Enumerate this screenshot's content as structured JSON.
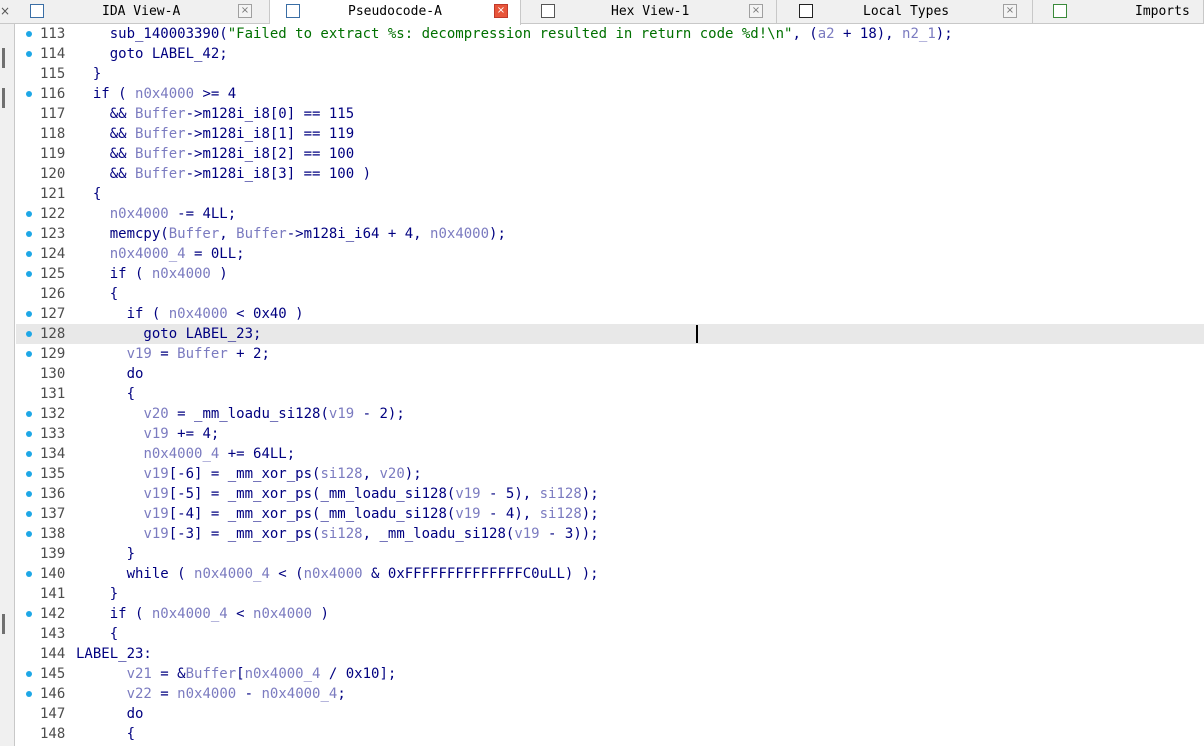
{
  "tabs": [
    {
      "label": "IDA View-A",
      "icon": "ida-view-icon",
      "active": false
    },
    {
      "label": "Pseudocode-A",
      "icon": "pseudocode-icon",
      "active": true
    },
    {
      "label": "Hex View-1",
      "icon": "hex-view-icon",
      "active": false
    },
    {
      "label": "Local Types",
      "icon": "local-types-icon",
      "active": false
    },
    {
      "label": "Imports",
      "icon": "imports-icon",
      "active": false
    }
  ],
  "close_glyph": "×",
  "code": {
    "lines": [
      {
        "n": "113",
        "dot": true,
        "t": [
          [
            "    sub_140003390(",
            ""
          ],
          [
            "\"Failed to extract %s: decompression resulted in return code %d!\\n\"",
            "str"
          ],
          [
            ", (",
            ""
          ],
          [
            "a2",
            "var"
          ],
          [
            " + 18), ",
            ""
          ],
          [
            "n2_1",
            "var"
          ],
          [
            ");",
            ""
          ]
        ]
      },
      {
        "n": "114",
        "dot": true,
        "t": [
          [
            "    goto LABEL_42;",
            ""
          ]
        ]
      },
      {
        "n": "115",
        "dot": false,
        "t": [
          [
            "  }",
            ""
          ]
        ]
      },
      {
        "n": "116",
        "dot": true,
        "t": [
          [
            "  if ( ",
            ""
          ],
          [
            "n0x4000",
            "var"
          ],
          [
            " >= 4",
            ""
          ]
        ]
      },
      {
        "n": "117",
        "dot": false,
        "t": [
          [
            "    && ",
            ""
          ],
          [
            "Buffer",
            "var"
          ],
          [
            "->m128i_i8[0] == 115",
            ""
          ]
        ]
      },
      {
        "n": "118",
        "dot": false,
        "t": [
          [
            "    && ",
            ""
          ],
          [
            "Buffer",
            "var"
          ],
          [
            "->m128i_i8[1] == 119",
            ""
          ]
        ]
      },
      {
        "n": "119",
        "dot": false,
        "t": [
          [
            "    && ",
            ""
          ],
          [
            "Buffer",
            "var"
          ],
          [
            "->m128i_i8[2] == 100",
            ""
          ]
        ]
      },
      {
        "n": "120",
        "dot": false,
        "t": [
          [
            "    && ",
            ""
          ],
          [
            "Buffer",
            "var"
          ],
          [
            "->m128i_i8[3] == 100 )",
            ""
          ]
        ]
      },
      {
        "n": "121",
        "dot": false,
        "t": [
          [
            "  {",
            ""
          ]
        ]
      },
      {
        "n": "122",
        "dot": true,
        "t": [
          [
            "    ",
            ""
          ],
          [
            "n0x4000",
            "var"
          ],
          [
            " -= 4LL;",
            ""
          ]
        ]
      },
      {
        "n": "123",
        "dot": true,
        "t": [
          [
            "    memcpy(",
            ""
          ],
          [
            "Buffer",
            "var"
          ],
          [
            ", ",
            ""
          ],
          [
            "Buffer",
            "var"
          ],
          [
            "->m128i_i64 + 4, ",
            ""
          ],
          [
            "n0x4000",
            "var"
          ],
          [
            ");",
            ""
          ]
        ]
      },
      {
        "n": "124",
        "dot": true,
        "t": [
          [
            "    ",
            ""
          ],
          [
            "n0x4000_4",
            "var"
          ],
          [
            " = 0LL;",
            ""
          ]
        ]
      },
      {
        "n": "125",
        "dot": true,
        "t": [
          [
            "    if ( ",
            ""
          ],
          [
            "n0x4000",
            "var"
          ],
          [
            " )",
            ""
          ]
        ]
      },
      {
        "n": "126",
        "dot": false,
        "t": [
          [
            "    {",
            ""
          ]
        ]
      },
      {
        "n": "127",
        "dot": true,
        "t": [
          [
            "      if ( ",
            ""
          ],
          [
            "n0x4000",
            "var"
          ],
          [
            " < 0x40 )",
            ""
          ]
        ]
      },
      {
        "n": "128",
        "dot": true,
        "t": [
          [
            "        goto LABEL_23;",
            ""
          ]
        ]
      },
      {
        "n": "129",
        "dot": true,
        "t": [
          [
            "      ",
            ""
          ],
          [
            "v19",
            "var"
          ],
          [
            " = ",
            ""
          ],
          [
            "Buffer",
            "var"
          ],
          [
            " + 2;",
            ""
          ]
        ]
      },
      {
        "n": "130",
        "dot": false,
        "t": [
          [
            "      do",
            ""
          ]
        ]
      },
      {
        "n": "131",
        "dot": false,
        "t": [
          [
            "      {",
            ""
          ]
        ]
      },
      {
        "n": "132",
        "dot": true,
        "t": [
          [
            "        ",
            ""
          ],
          [
            "v20",
            "var"
          ],
          [
            " = _mm_loadu_si128(",
            ""
          ],
          [
            "v19",
            "var"
          ],
          [
            " - 2);",
            ""
          ]
        ]
      },
      {
        "n": "133",
        "dot": true,
        "t": [
          [
            "        ",
            ""
          ],
          [
            "v19",
            "var"
          ],
          [
            " += 4;",
            ""
          ]
        ]
      },
      {
        "n": "134",
        "dot": true,
        "t": [
          [
            "        ",
            ""
          ],
          [
            "n0x4000_4",
            "var"
          ],
          [
            " += 64LL;",
            ""
          ]
        ]
      },
      {
        "n": "135",
        "dot": true,
        "t": [
          [
            "        ",
            ""
          ],
          [
            "v19",
            "var"
          ],
          [
            "[-6] = _mm_xor_ps(",
            ""
          ],
          [
            "si128",
            "var"
          ],
          [
            ", ",
            ""
          ],
          [
            "v20",
            "var"
          ],
          [
            ");",
            ""
          ]
        ]
      },
      {
        "n": "136",
        "dot": true,
        "t": [
          [
            "        ",
            ""
          ],
          [
            "v19",
            "var"
          ],
          [
            "[-5] = _mm_xor_ps(_mm_loadu_si128(",
            ""
          ],
          [
            "v19",
            "var"
          ],
          [
            " - 5), ",
            ""
          ],
          [
            "si128",
            "var"
          ],
          [
            ");",
            ""
          ]
        ]
      },
      {
        "n": "137",
        "dot": true,
        "t": [
          [
            "        ",
            ""
          ],
          [
            "v19",
            "var"
          ],
          [
            "[-4] = _mm_xor_ps(_mm_loadu_si128(",
            ""
          ],
          [
            "v19",
            "var"
          ],
          [
            " - 4), ",
            ""
          ],
          [
            "si128",
            "var"
          ],
          [
            ");",
            ""
          ]
        ]
      },
      {
        "n": "138",
        "dot": true,
        "t": [
          [
            "        ",
            ""
          ],
          [
            "v19",
            "var"
          ],
          [
            "[-3] = _mm_xor_ps(",
            ""
          ],
          [
            "si128",
            "var"
          ],
          [
            ", _mm_loadu_si128(",
            ""
          ],
          [
            "v19",
            "var"
          ],
          [
            " - 3));",
            ""
          ]
        ]
      },
      {
        "n": "139",
        "dot": false,
        "t": [
          [
            "      }",
            ""
          ]
        ]
      },
      {
        "n": "140",
        "dot": true,
        "t": [
          [
            "      while ( ",
            ""
          ],
          [
            "n0x4000_4",
            "var"
          ],
          [
            " < (",
            ""
          ],
          [
            "n0x4000",
            "var"
          ],
          [
            " & 0xFFFFFFFFFFFFFFC0uLL) );",
            ""
          ]
        ]
      },
      {
        "n": "141",
        "dot": false,
        "t": [
          [
            "    }",
            ""
          ]
        ]
      },
      {
        "n": "142",
        "dot": true,
        "t": [
          [
            "    if ( ",
            ""
          ],
          [
            "n0x4000_4",
            "var"
          ],
          [
            " < ",
            ""
          ],
          [
            "n0x4000",
            "var"
          ],
          [
            " )",
            ""
          ]
        ]
      },
      {
        "n": "143",
        "dot": false,
        "t": [
          [
            "    {",
            ""
          ]
        ]
      },
      {
        "n": "144",
        "dot": false,
        "t": [
          [
            "LABEL_23:",
            ""
          ]
        ]
      },
      {
        "n": "145",
        "dot": true,
        "t": [
          [
            "      ",
            ""
          ],
          [
            "v21",
            "var"
          ],
          [
            " = &",
            ""
          ],
          [
            "Buffer",
            "var"
          ],
          [
            "[",
            ""
          ],
          [
            "n0x4000_4",
            "var"
          ],
          [
            " / 0x10];",
            ""
          ]
        ]
      },
      {
        "n": "146",
        "dot": true,
        "t": [
          [
            "      ",
            ""
          ],
          [
            "v22",
            "var"
          ],
          [
            " = ",
            ""
          ],
          [
            "n0x4000",
            "var"
          ],
          [
            " - ",
            ""
          ],
          [
            "n0x4000_4",
            "var"
          ],
          [
            ";",
            ""
          ]
        ]
      },
      {
        "n": "147",
        "dot": false,
        "t": [
          [
            "      do",
            ""
          ]
        ]
      },
      {
        "n": "148",
        "dot": false,
        "t": [
          [
            "      {",
            ""
          ]
        ]
      }
    ],
    "current_line": "128"
  }
}
